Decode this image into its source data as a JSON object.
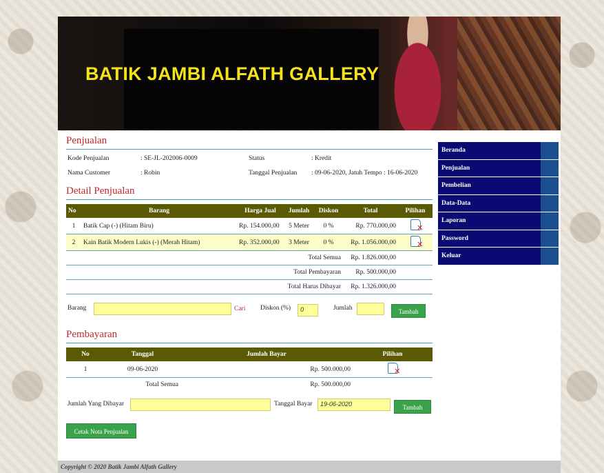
{
  "site": {
    "title": "BATIK JAMBI ALFATH GALLERY",
    "footer": "Copyright © 2020 Batik Jambi Alfath Gallery"
  },
  "menu": [
    "Beranda",
    "Penjualan",
    "Pembelian",
    "Data-Data",
    "Laporan",
    "Password",
    "Keluar"
  ],
  "sale": {
    "heading": "Penjualan",
    "kode_label": "Kode Penjualan",
    "kode_value": ": SE-JL-202006-0009",
    "status_label": "Status",
    "status_value": ": Kredit",
    "customer_label": "Nama Customer",
    "customer_value": ": Robin",
    "tanggal_label": "Tanggal Penjualan",
    "tanggal_value": ": 09-06-2020, Jatuh Tempo : 16-06-2020"
  },
  "detail": {
    "heading": "Detail Penjualan",
    "headers": [
      "No",
      "Barang",
      "Harga Jual",
      "Jumlah",
      "Diskon",
      "Total",
      "Pilihan"
    ],
    "rows": [
      [
        "1",
        "Batik Cap (-) (Hitam Biru)",
        "Rp. 154.000,00",
        "5 Meter",
        "0 %",
        "Rp. 770.000,00"
      ],
      [
        "2",
        "Kain Batik Modern Lukis (-) (Merah Hitam)",
        "Rp. 352.000,00",
        "3 Meter",
        "0 %",
        "Rp. 1.056.000,00"
      ]
    ],
    "total_semua_label": "Total Semua",
    "total_semua": "Rp. 1.826.000,00",
    "total_pembayaran_label": "Total Pembayaran",
    "total_pembayaran": "Rp. 500.000,00",
    "total_harus_label": "Total Harus Dibayar",
    "total_harus": "Rp. 1.326.000,00"
  },
  "add_item": {
    "barang_label": "Barang",
    "cari": "Cari",
    "diskon_label": "Diskon (%)",
    "diskon_value": "0",
    "jumlah_label": "Jumlah",
    "tambah": "Tambah"
  },
  "payment": {
    "heading": "Pembayaran",
    "headers": [
      "No",
      "Tanggal",
      "Jumlah Bayar",
      "Pilihan"
    ],
    "rows": [
      [
        "1",
        "09-06-2020",
        "Rp. 500.000,00"
      ]
    ],
    "total_label": "Total Semua",
    "total_value": "Rp. 500.000,00",
    "jumlah_label": "Jumlah Yang Dibayar",
    "tanggal_label": "Tanggal Bayar",
    "tanggal_value": "19-06-2020",
    "tambah": "Tambah"
  },
  "cetak": "Cetak Nota Penjualan"
}
